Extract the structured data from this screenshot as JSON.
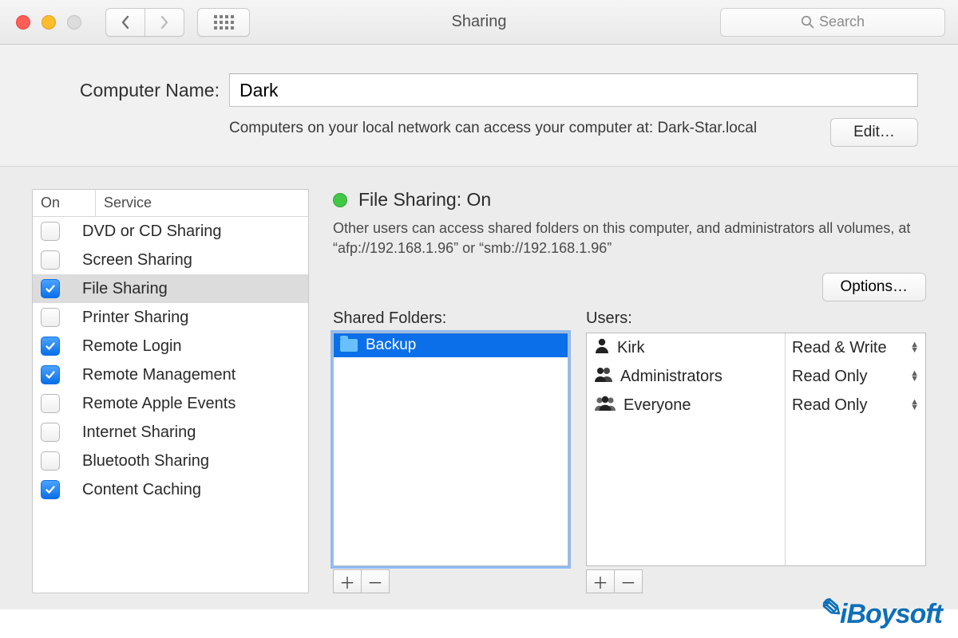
{
  "window": {
    "title": "Sharing",
    "search_placeholder": "Search"
  },
  "computer": {
    "label": "Computer Name:",
    "value": "Dark",
    "hint": "Computers on your local network can access your computer at: Dark-Star.local",
    "edit_label": "Edit…"
  },
  "services": {
    "header_on": "On",
    "header_service": "Service",
    "items": [
      {
        "label": "DVD or CD Sharing",
        "on": false,
        "selected": false
      },
      {
        "label": "Screen Sharing",
        "on": false,
        "selected": false
      },
      {
        "label": "File Sharing",
        "on": true,
        "selected": true
      },
      {
        "label": "Printer Sharing",
        "on": false,
        "selected": false
      },
      {
        "label": "Remote Login",
        "on": true,
        "selected": false
      },
      {
        "label": "Remote Management",
        "on": true,
        "selected": false
      },
      {
        "label": "Remote Apple Events",
        "on": false,
        "selected": false
      },
      {
        "label": "Internet Sharing",
        "on": false,
        "selected": false
      },
      {
        "label": "Bluetooth Sharing",
        "on": false,
        "selected": false
      },
      {
        "label": "Content Caching",
        "on": true,
        "selected": false
      }
    ]
  },
  "detail": {
    "status_title": "File Sharing: On",
    "status_on": true,
    "status_desc": "Other users can access shared folders on this computer, and administrators all volumes, at “afp://192.168.1.96” or “smb://192.168.1.96”",
    "options_label": "Options…",
    "folders_label": "Shared Folders:",
    "folders": [
      {
        "name": "Backup",
        "selected": true
      }
    ],
    "users_label": "Users:",
    "users": [
      {
        "name": "Kirk",
        "icon": "person",
        "permission": "Read & Write"
      },
      {
        "name": "Administrators",
        "icon": "group2",
        "permission": "Read Only"
      },
      {
        "name": "Everyone",
        "icon": "group3",
        "permission": "Read Only"
      }
    ]
  },
  "watermark": "iBoysoft"
}
